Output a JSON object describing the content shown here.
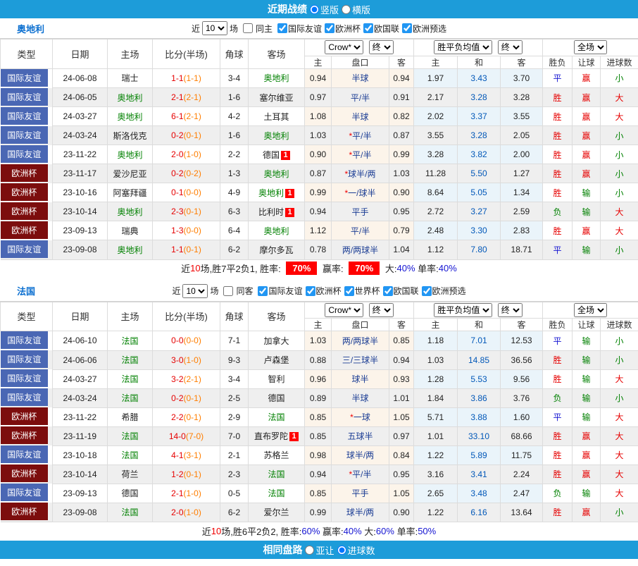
{
  "top_bar": {
    "title": "近期战绩",
    "options": [
      {
        "label": "竖版",
        "selected": true
      },
      {
        "label": "横版",
        "selected": false
      }
    ]
  },
  "bottom_bar": {
    "title": "相同盘路",
    "options": [
      {
        "label": "亚让",
        "selected": false
      },
      {
        "label": "进球数",
        "selected": true
      }
    ]
  },
  "columns": {
    "main": [
      "类型",
      "日期",
      "主场",
      "比分(半场)",
      "角球",
      "客场"
    ],
    "sub": [
      "主",
      "盘口",
      "客",
      "主",
      "和",
      "客",
      "胜负",
      "让球",
      "进球数"
    ],
    "selects": {
      "book": "Crow*",
      "final": "终",
      "europe": "胜平负均值",
      "final2": "终",
      "scope": "全场"
    }
  },
  "league_colors": {
    "国际友谊": "#4a67b4",
    "欧洲杯": "#7c0d0d"
  },
  "result_colors": {
    "胜": "r",
    "负": "g",
    "平": "b",
    "赢": "r",
    "输": "g",
    "大": "r",
    "小": "g"
  },
  "sections": [
    {
      "team": "奥地利",
      "filter": {
        "prefix": "近",
        "count": "10",
        "suffix": "场",
        "same": "同主",
        "same_checked": false,
        "leagues": [
          "国际友谊",
          "欧洲杯",
          "欧国联",
          "欧洲预选"
        ]
      },
      "rows": [
        {
          "league": "国际友谊",
          "date": "24-06-08",
          "home": "瑞士",
          "hg": false,
          "hb": "",
          "score": "1-1",
          "half": "(1-1)",
          "corner": "3-4",
          "away": "奥地利",
          "ag": true,
          "ab": "",
          "ow": "0.94",
          "star": false,
          "hcap": "半球",
          "ol": "0.94",
          "eh": "1.97",
          "ed": "3.43",
          "ea": "3.70",
          "r1": "平",
          "r2": "赢",
          "r3": "小"
        },
        {
          "league": "国际友谊",
          "date": "24-06-05",
          "home": "奥地利",
          "hg": true,
          "hb": "",
          "score": "2-1",
          "half": "(2-1)",
          "corner": "1-6",
          "away": "塞尔维亚",
          "ag": false,
          "ab": "",
          "ow": "0.97",
          "star": false,
          "hcap": "平/半",
          "ol": "0.91",
          "eh": "2.17",
          "ed": "3.28",
          "ea": "3.28",
          "r1": "胜",
          "r2": "赢",
          "r3": "大"
        },
        {
          "league": "国际友谊",
          "date": "24-03-27",
          "home": "奥地利",
          "hg": true,
          "hb": "",
          "score": "6-1",
          "half": "(2-1)",
          "corner": "4-2",
          "away": "土耳其",
          "ag": false,
          "ab": "",
          "ow": "1.08",
          "star": false,
          "hcap": "半球",
          "ol": "0.82",
          "eh": "2.02",
          "ed": "3.37",
          "ea": "3.55",
          "r1": "胜",
          "r2": "赢",
          "r3": "大"
        },
        {
          "league": "国际友谊",
          "date": "24-03-24",
          "home": "斯洛伐克",
          "hg": false,
          "hb": "",
          "score": "0-2",
          "half": "(0-1)",
          "corner": "1-6",
          "away": "奥地利",
          "ag": true,
          "ab": "",
          "ow": "1.03",
          "star": true,
          "hcap": "平/半",
          "ol": "0.87",
          "eh": "3.55",
          "ed": "3.28",
          "ea": "2.05",
          "r1": "胜",
          "r2": "赢",
          "r3": "小"
        },
        {
          "league": "国际友谊",
          "date": "23-11-22",
          "home": "奥地利",
          "hg": true,
          "hb": "",
          "score": "2-0",
          "half": "(1-0)",
          "corner": "2-2",
          "away": "德国",
          "ag": false,
          "ab": "1",
          "ow": "0.90",
          "star": true,
          "hcap": "平/半",
          "ol": "0.99",
          "eh": "3.28",
          "ed": "3.82",
          "ea": "2.00",
          "r1": "胜",
          "r2": "赢",
          "r3": "小"
        },
        {
          "league": "欧洲杯",
          "date": "23-11-17",
          "home": "爱沙尼亚",
          "hg": false,
          "hb": "",
          "score": "0-2",
          "half": "(0-2)",
          "corner": "1-3",
          "away": "奥地利",
          "ag": true,
          "ab": "",
          "ow": "0.87",
          "star": true,
          "hcap": "球半/两",
          "ol": "1.03",
          "eh": "11.28",
          "ed": "5.50",
          "ea": "1.27",
          "r1": "胜",
          "r2": "赢",
          "r3": "小"
        },
        {
          "league": "欧洲杯",
          "date": "23-10-16",
          "home": "阿塞拜疆",
          "hg": false,
          "hb": "",
          "score": "0-1",
          "half": "(0-0)",
          "corner": "4-9",
          "away": "奥地利",
          "ag": true,
          "ab": "1",
          "ow": "0.99",
          "star": true,
          "hcap": "一/球半",
          "ol": "0.90",
          "eh": "8.64",
          "ed": "5.05",
          "ea": "1.34",
          "r1": "胜",
          "r2": "输",
          "r3": "小"
        },
        {
          "league": "欧洲杯",
          "date": "23-10-14",
          "home": "奥地利",
          "hg": true,
          "hb": "",
          "score": "2-3",
          "half": "(0-1)",
          "corner": "6-3",
          "away": "比利时",
          "ag": false,
          "ab": "1",
          "ow": "0.94",
          "star": false,
          "hcap": "平手",
          "ol": "0.95",
          "eh": "2.72",
          "ed": "3.27",
          "ea": "2.59",
          "r1": "负",
          "r2": "输",
          "r3": "大"
        },
        {
          "league": "欧洲杯",
          "date": "23-09-13",
          "home": "瑞典",
          "hg": false,
          "hb": "",
          "score": "1-3",
          "half": "(0-0)",
          "corner": "6-4",
          "away": "奥地利",
          "ag": true,
          "ab": "",
          "ow": "1.12",
          "star": false,
          "hcap": "平/半",
          "ol": "0.79",
          "eh": "2.48",
          "ed": "3.30",
          "ea": "2.83",
          "r1": "胜",
          "r2": "赢",
          "r3": "大"
        },
        {
          "league": "国际友谊",
          "date": "23-09-08",
          "home": "奥地利",
          "hg": true,
          "hb": "",
          "score": "1-1",
          "half": "(0-1)",
          "corner": "6-2",
          "away": "摩尔多瓦",
          "ag": false,
          "ab": "",
          "ow": "0.78",
          "star": false,
          "hcap": "两/两球半",
          "ol": "1.04",
          "eh": "1.12",
          "ed": "7.80",
          "ea": "18.71",
          "r1": "平",
          "r2": "输",
          "r3": "小"
        }
      ],
      "summary": [
        {
          "t": "近",
          "s": "plain"
        },
        {
          "t": "10",
          "s": "red"
        },
        {
          "t": "场,胜7平2负1, 胜率: ",
          "s": "plain"
        },
        {
          "t": "70%",
          "s": "badge"
        },
        {
          "t": " 赢率: ",
          "s": "plain"
        },
        {
          "t": "70%",
          "s": "badge"
        },
        {
          "t": " 大:",
          "s": "plain"
        },
        {
          "t": "40%",
          "s": "blue"
        },
        {
          "t": " 单率:",
          "s": "plain"
        },
        {
          "t": "40%",
          "s": "blue"
        }
      ]
    },
    {
      "team": "法国",
      "filter": {
        "prefix": "近",
        "count": "10",
        "suffix": "场",
        "same": "同客",
        "same_checked": false,
        "leagues": [
          "国际友谊",
          "欧洲杯",
          "世界杯",
          "欧国联",
          "欧洲预选"
        ]
      },
      "rows": [
        {
          "league": "国际友谊",
          "date": "24-06-10",
          "home": "法国",
          "hg": true,
          "hb": "",
          "score": "0-0",
          "half": "(0-0)",
          "corner": "7-1",
          "away": "加拿大",
          "ag": false,
          "ab": "",
          "ow": "1.03",
          "star": false,
          "hcap": "两/两球半",
          "ol": "0.85",
          "eh": "1.18",
          "ed": "7.01",
          "ea": "12.53",
          "r1": "平",
          "r2": "输",
          "r3": "小"
        },
        {
          "league": "国际友谊",
          "date": "24-06-06",
          "home": "法国",
          "hg": true,
          "hb": "",
          "score": "3-0",
          "half": "(1-0)",
          "corner": "9-3",
          "away": "卢森堡",
          "ag": false,
          "ab": "",
          "ow": "0.88",
          "star": false,
          "hcap": "三/三球半",
          "ol": "0.94",
          "eh": "1.03",
          "ed": "14.85",
          "ea": "36.56",
          "r1": "胜",
          "r2": "输",
          "r3": "小"
        },
        {
          "league": "国际友谊",
          "date": "24-03-27",
          "home": "法国",
          "hg": true,
          "hb": "",
          "score": "3-2",
          "half": "(2-1)",
          "corner": "3-4",
          "away": "智利",
          "ag": false,
          "ab": "",
          "ow": "0.96",
          "star": false,
          "hcap": "球半",
          "ol": "0.93",
          "eh": "1.28",
          "ed": "5.53",
          "ea": "9.56",
          "r1": "胜",
          "r2": "输",
          "r3": "大"
        },
        {
          "league": "国际友谊",
          "date": "24-03-24",
          "home": "法国",
          "hg": true,
          "hb": "",
          "score": "0-2",
          "half": "(0-1)",
          "corner": "2-5",
          "away": "德国",
          "ag": false,
          "ab": "",
          "ow": "0.89",
          "star": false,
          "hcap": "半球",
          "ol": "1.01",
          "eh": "1.84",
          "ed": "3.86",
          "ea": "3.76",
          "r1": "负",
          "r2": "输",
          "r3": "小"
        },
        {
          "league": "欧洲杯",
          "date": "23-11-22",
          "home": "希腊",
          "hg": false,
          "hb": "",
          "score": "2-2",
          "half": "(0-1)",
          "corner": "2-9",
          "away": "法国",
          "ag": true,
          "ab": "",
          "ow": "0.85",
          "star": true,
          "hcap": "一球",
          "ol": "1.05",
          "eh": "5.71",
          "ed": "3.88",
          "ea": "1.60",
          "r1": "平",
          "r2": "输",
          "r3": "大"
        },
        {
          "league": "欧洲杯",
          "date": "23-11-19",
          "home": "法国",
          "hg": true,
          "hb": "",
          "score": "14-0",
          "half": "(7-0)",
          "corner": "7-0",
          "away": "直布罗陀",
          "ag": false,
          "ab": "1",
          "ow": "0.85",
          "star": false,
          "hcap": "五球半",
          "ol": "0.97",
          "eh": "1.01",
          "ed": "33.10",
          "ea": "68.66",
          "r1": "胜",
          "r2": "赢",
          "r3": "大"
        },
        {
          "league": "国际友谊",
          "date": "23-10-18",
          "home": "法国",
          "hg": true,
          "hb": "",
          "score": "4-1",
          "half": "(3-1)",
          "corner": "2-1",
          "away": "苏格兰",
          "ag": false,
          "ab": "",
          "ow": "0.98",
          "star": false,
          "hcap": "球半/两",
          "ol": "0.84",
          "eh": "1.22",
          "ed": "5.89",
          "ea": "11.75",
          "r1": "胜",
          "r2": "赢",
          "r3": "大"
        },
        {
          "league": "欧洲杯",
          "date": "23-10-14",
          "home": "荷兰",
          "hg": false,
          "hb": "",
          "score": "1-2",
          "half": "(0-1)",
          "corner": "2-3",
          "away": "法国",
          "ag": true,
          "ab": "",
          "ow": "0.94",
          "star": true,
          "hcap": "平/半",
          "ol": "0.95",
          "eh": "3.16",
          "ed": "3.41",
          "ea": "2.24",
          "r1": "胜",
          "r2": "赢",
          "r3": "大"
        },
        {
          "league": "国际友谊",
          "date": "23-09-13",
          "home": "德国",
          "hg": false,
          "hb": "",
          "score": "2-1",
          "half": "(1-0)",
          "corner": "0-5",
          "away": "法国",
          "ag": true,
          "ab": "",
          "ow": "0.85",
          "star": false,
          "hcap": "平手",
          "ol": "1.05",
          "eh": "2.65",
          "ed": "3.48",
          "ea": "2.47",
          "r1": "负",
          "r2": "输",
          "r3": "大"
        },
        {
          "league": "欧洲杯",
          "date": "23-09-08",
          "home": "法国",
          "hg": true,
          "hb": "",
          "score": "2-0",
          "half": "(1-0)",
          "corner": "6-2",
          "away": "爱尔兰",
          "ag": false,
          "ab": "",
          "ow": "0.99",
          "star": false,
          "hcap": "球半/两",
          "ol": "0.90",
          "eh": "1.22",
          "ed": "6.16",
          "ea": "13.64",
          "r1": "胜",
          "r2": "赢",
          "r3": "小"
        }
      ],
      "summary": [
        {
          "t": "近",
          "s": "plain"
        },
        {
          "t": "10",
          "s": "red"
        },
        {
          "t": "场,胜6平2负2, 胜率:",
          "s": "plain"
        },
        {
          "t": "60%",
          "s": "blue"
        },
        {
          "t": " 赢率:",
          "s": "plain"
        },
        {
          "t": "40%",
          "s": "blue"
        },
        {
          "t": " 大:",
          "s": "plain"
        },
        {
          "t": "60%",
          "s": "blue"
        },
        {
          "t": " 单率:",
          "s": "plain"
        },
        {
          "t": "50%",
          "s": "blue"
        }
      ]
    }
  ]
}
